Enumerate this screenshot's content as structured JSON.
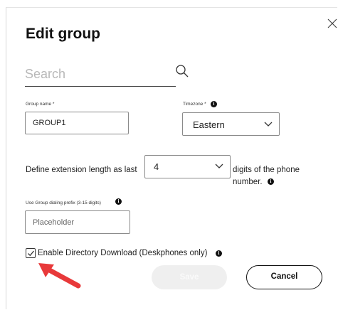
{
  "dialog": {
    "title": "Edit group",
    "accent_color": "#e8393a"
  },
  "search": {
    "placeholder": "Search",
    "value": ""
  },
  "group_name": {
    "label": "Group name *",
    "value": "GROUP1"
  },
  "timezone": {
    "label": "Timezone *",
    "value": "Eastern"
  },
  "extension": {
    "prefix_text": "Define extension length as last",
    "value": "4",
    "suffix_line1": "digits of the phone",
    "suffix_line2": "number."
  },
  "dialing_prefix": {
    "label": "Use Group dialing prefix (3-15 digits)",
    "placeholder": "Placeholder",
    "value": ""
  },
  "directory_download": {
    "label": "Enable Directory Download (Deskphones only)",
    "checked": true
  },
  "buttons": {
    "save_label": "Save",
    "cancel_label": "Cancel"
  },
  "icons": {
    "close": "close-icon",
    "search": "search-icon",
    "info": "info-icon",
    "chevron": "chevron-down-icon",
    "check": "checkmark-icon",
    "annotation_arrow": "red-arrow"
  }
}
